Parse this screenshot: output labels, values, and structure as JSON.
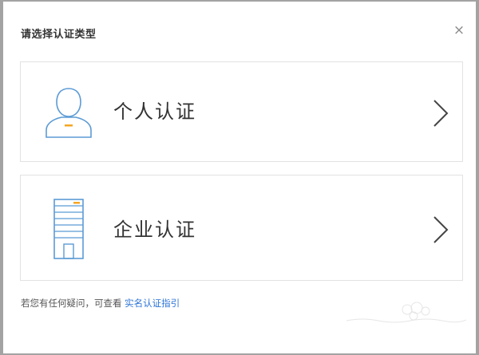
{
  "dialog": {
    "title": "请选择认证类型",
    "close_glyph": "×"
  },
  "options": [
    {
      "label": "个人认证",
      "icon": "person-icon"
    },
    {
      "label": "企业认证",
      "icon": "building-icon"
    }
  ],
  "footer": {
    "text": "若您有任何疑问，可查看 ",
    "link": "实名认证指引"
  },
  "colors": {
    "accent": "#2b73d6",
    "icon_line": "#5b9bd5",
    "icon_highlight": "#f5a623"
  }
}
